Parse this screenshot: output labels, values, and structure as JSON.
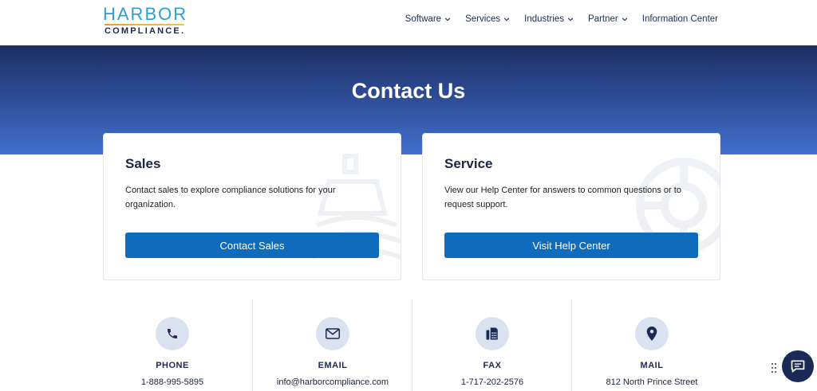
{
  "brand": {
    "name_top": "HARBOR",
    "name_bottom": "COMPLIANCE."
  },
  "nav": [
    {
      "label": "Software"
    },
    {
      "label": "Services"
    },
    {
      "label": "Industries"
    },
    {
      "label": "Partner"
    },
    {
      "label": "Information Center"
    }
  ],
  "hero": {
    "title": "Contact Us"
  },
  "cards": {
    "sales": {
      "title": "Sales",
      "description": "Contact sales to explore compliance solutions for your organization.",
      "button": "Contact Sales"
    },
    "service": {
      "title": "Service",
      "description": "View our Help Center for answers to common questions or to request support.",
      "button": "Visit Help Center"
    }
  },
  "contact": {
    "phone": {
      "label": "PHONE",
      "value": "1-888-995-5895",
      "icon": "phone-icon"
    },
    "email": {
      "label": "EMAIL",
      "value": "info@harborcompliance.com",
      "icon": "envelope-icon"
    },
    "fax": {
      "label": "FAX",
      "value": "1-717-202-2576",
      "icon": "fax-icon"
    },
    "mail": {
      "label": "MAIL",
      "value": "812 North Prince Street",
      "icon": "map-pin-icon"
    }
  },
  "colors": {
    "primary_button": "#0f6cbd",
    "hero_top": "#1d2f62",
    "hero_bottom": "#4270cc",
    "logo_blue": "#2a9fd8",
    "logo_orange": "#f3a01a",
    "navy": "#1b2a55"
  }
}
